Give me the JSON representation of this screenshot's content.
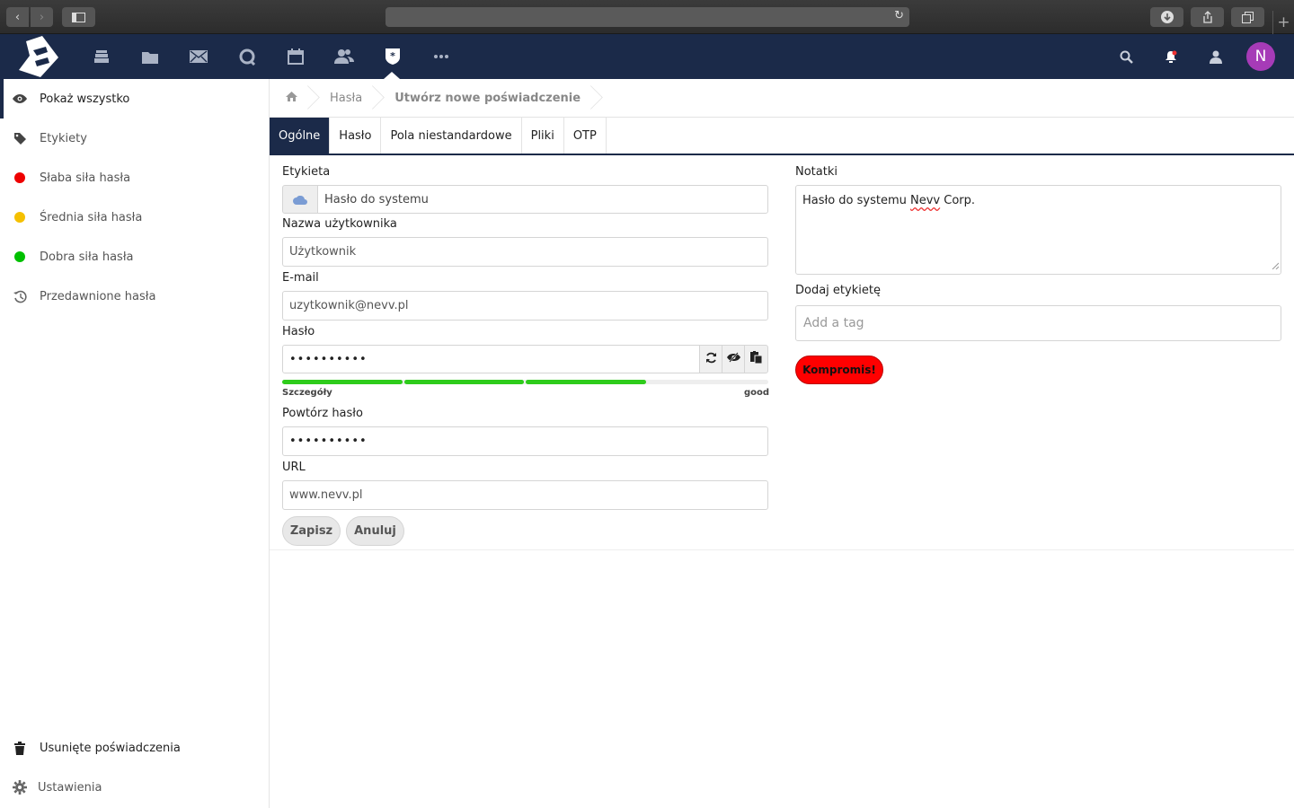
{
  "app": {
    "avatar_letter": "N",
    "nav_icons": [
      "dashboard-icon",
      "files-icon",
      "mail-icon",
      "talk-icon",
      "calendar-icon",
      "contacts-icon",
      "passwords-icon",
      "more-icon"
    ]
  },
  "sidebar": {
    "items": [
      {
        "label": "Pokaż wszystko",
        "icon": "eye-icon"
      },
      {
        "label": "Etykiety",
        "icon": "tag-icon"
      },
      {
        "label": "Słaba siła hasła",
        "color": "#ee0000"
      },
      {
        "label": "Średnia siła hasła",
        "color": "#f5c000"
      },
      {
        "label": "Dobra siła hasła",
        "color": "#00c000"
      },
      {
        "label": "Przedawnione hasła",
        "icon": "history-icon"
      }
    ],
    "trash_label": "Usunięte poświadczenia",
    "settings_label": "Ustawienia"
  },
  "breadcrumb": {
    "section": "Hasła",
    "current": "Utwórz nowe poświadczenie"
  },
  "tabs": [
    "Ogólne",
    "Hasło",
    "Pola niestandardowe",
    "Pliki",
    "OTP"
  ],
  "form": {
    "label_label": "Etykieta",
    "label_value": "Hasło do systemu",
    "username_label": "Nazwa użytkownika",
    "username_value": "Użytkownik",
    "email_label": "E-mail",
    "email_value": "uzytkownik@nevv.pl",
    "password_label": "Hasło",
    "password_value": "••••••••••",
    "strength_details": "Szczegóły",
    "strength_text": "good",
    "strength_level": 0.75,
    "repeat_label": "Powtórz hasło",
    "repeat_value": "••••••••••",
    "url_label": "URL",
    "url_value": "www.nevv.pl",
    "save_label": "Zapisz",
    "cancel_label": "Anuluj",
    "notes_label": "Notatki",
    "notes_prefix": "Hasło do systemu ",
    "notes_word": "Nevv",
    "notes_suffix": " Corp.",
    "tag_label": "Dodaj etykietę",
    "tag_placeholder": "Add a tag",
    "compromise_label": "Kompromis!"
  },
  "colors": {
    "header": "#1b2a49",
    "strength_green": "#2ecc1b",
    "compromise_red": "#ff0000"
  }
}
